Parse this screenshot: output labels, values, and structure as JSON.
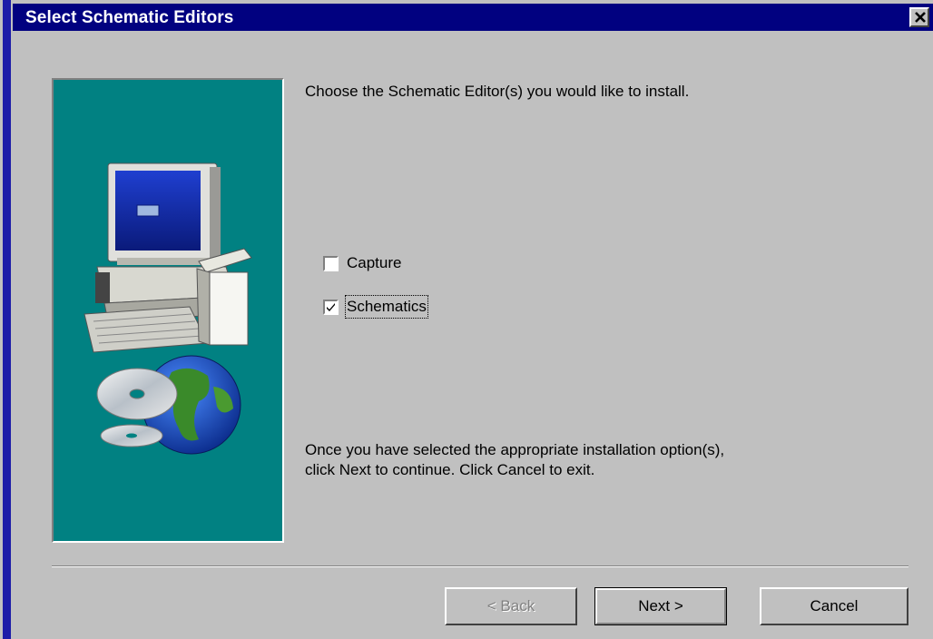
{
  "window": {
    "title": "Select Schematic Editors",
    "close_glyph": "✕"
  },
  "content": {
    "instruction": "Choose the Schematic Editor(s) you would like to install.",
    "options": [
      {
        "label": "Capture",
        "checked": false
      },
      {
        "label": "Schematics",
        "checked": true
      }
    ],
    "footer_line1": "Once you have selected the appropriate installation option(s),",
    "footer_line2": "click Next to continue. Click Cancel to exit."
  },
  "buttons": {
    "back": "< Back",
    "next": "Next >",
    "cancel": "Cancel"
  },
  "colors": {
    "titlebar": "#010180",
    "panel": "#018182",
    "face": "#c0c0c0"
  },
  "icons": {
    "illustration": "computer-with-cd-and-globe-illustration",
    "close": "close-icon",
    "check": "checkmark-icon"
  }
}
